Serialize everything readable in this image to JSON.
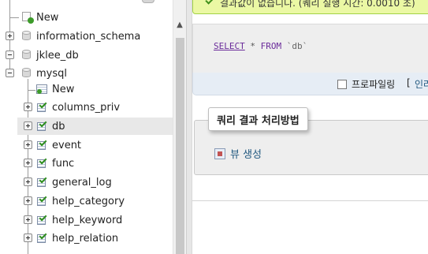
{
  "nav": {
    "top_new": "New",
    "databases": [
      {
        "label": "information_schema",
        "state": "collapsed"
      },
      {
        "label": "jklee_db",
        "state": "expanded"
      },
      {
        "label": "mysql",
        "state": "expanded"
      }
    ],
    "mysql_new": "New",
    "tables": [
      {
        "label": "columns_priv"
      },
      {
        "label": "db",
        "selected": true
      },
      {
        "label": "event"
      },
      {
        "label": "func"
      },
      {
        "label": "general_log"
      },
      {
        "label": "help_category"
      },
      {
        "label": "help_keyword"
      },
      {
        "label": "help_relation"
      }
    ]
  },
  "main": {
    "success_text": "결과값이 없습니다. (퀘리 실행 시간: 0.0010 초)",
    "sql": {
      "select": "SELECT",
      "star": "*",
      "from": "FROM",
      "table": "`db`"
    },
    "profiling": {
      "label": "프로파일링",
      "bracket": "[",
      "link": "인라인"
    },
    "query_results": {
      "legend": "쿼리 결과 처리방법",
      "create_view": "뷰 생성"
    }
  },
  "colors": {
    "success_bg": "#ebf8a4",
    "link": "#235a81",
    "sql_keyword": "#6a2b9a",
    "selected_row": "#e8e8e8"
  }
}
